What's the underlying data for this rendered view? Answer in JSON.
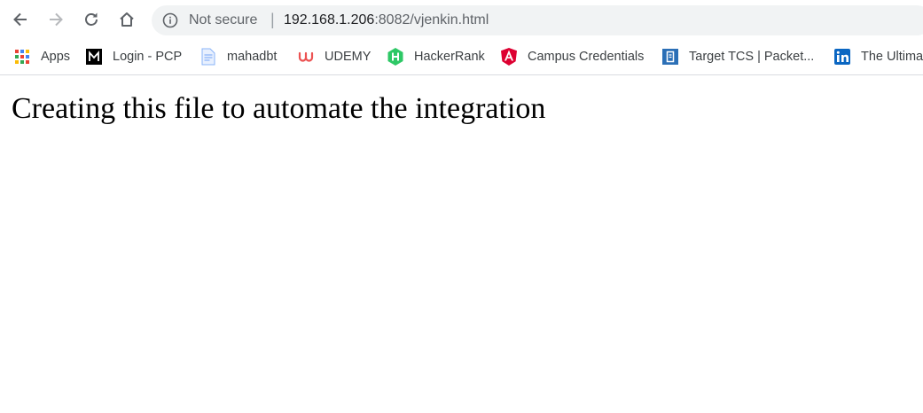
{
  "browser": {
    "security_label": "Not secure",
    "separator": "|",
    "url_host": "192.168.1.206",
    "url_rest": ":8082/vjenkin.html",
    "nav_icons": [
      "back-arrow-icon",
      "forward-arrow-icon",
      "reload-icon",
      "home-icon"
    ]
  },
  "bookmarks": [
    {
      "label": "Apps",
      "icon": "apps-grid-icon"
    },
    {
      "label": "Login - PCP",
      "icon": "m-logo-icon"
    },
    {
      "label": "mahadbt",
      "icon": "document-icon"
    },
    {
      "label": "UDEMY",
      "icon": "udemy-logo-icon"
    },
    {
      "label": "HackerRank",
      "icon": "hackerrank-logo-icon"
    },
    {
      "label": "Campus Credentials",
      "icon": "angular-logo-icon"
    },
    {
      "label": "Target TCS | Packet...",
      "icon": "packet-logo-icon"
    },
    {
      "label": "The Ultima",
      "icon": "linkedin-logo-icon"
    }
  ],
  "page": {
    "heading": "Creating this file to automate the integration"
  },
  "colors": {
    "omnibox_bg": "#f1f3f4",
    "udemy": "#ec5252",
    "hackerrank": "#2ec866",
    "angular": "#dd0031",
    "linkedin": "#0a66c2",
    "packet": "#2b6fb6"
  }
}
